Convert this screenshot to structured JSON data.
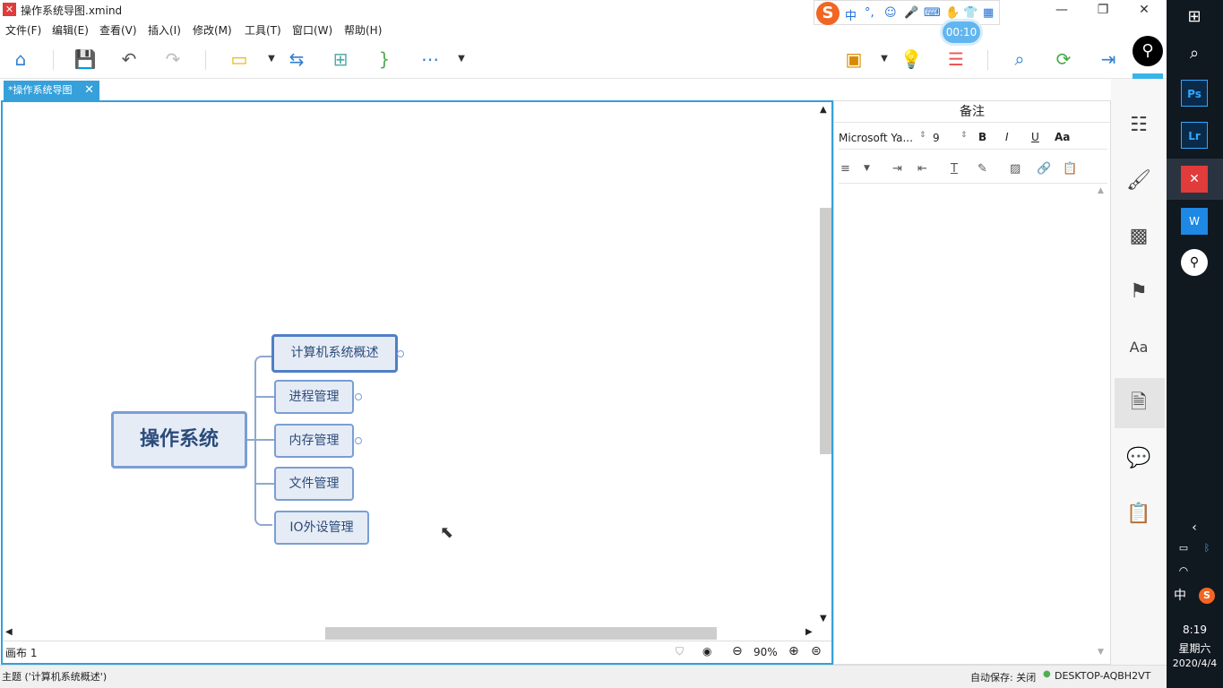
{
  "window": {
    "title": "操作系统导图.xmind",
    "app_logo": "✕"
  },
  "ime": {
    "logo": "S",
    "items": [
      "中",
      "°,",
      "☺",
      "mic",
      "⌨",
      "hand",
      "shirt",
      "grid"
    ],
    "timer": "00:10"
  },
  "menu": [
    "文件(F)",
    "编辑(E)",
    "查看(V)",
    "插入(I)",
    "修改(M)",
    "工具(T)",
    "窗口(W)",
    "帮助(H)"
  ],
  "tab": {
    "label": "*操作系统导图"
  },
  "mindmap": {
    "central": "操作系统",
    "topics": [
      "计算机系统概述",
      "进程管理",
      "内存管理",
      "文件管理",
      "IO外设管理"
    ]
  },
  "canvas_status": {
    "sheet": "画布 1",
    "zoom": "90%"
  },
  "notes": {
    "title": "备注",
    "font": "Microsoft Ya...",
    "size": "9",
    "bold": "B",
    "italic": "I",
    "underline": "U",
    "case": "Aa"
  },
  "status": {
    "selection": "主题 ('计算机系统概述')",
    "autosave": "自动保存: 关闭",
    "machine": "DESKTOP-AQBH2VT"
  },
  "taskbar": {
    "time": "8:19",
    "weekday": "星期六",
    "date": "2020/4/4",
    "ime": "中"
  },
  "colors": {
    "accent": "#35a0da",
    "node_border": "#7a9ed3",
    "node_fill": "#e6ecf6"
  }
}
